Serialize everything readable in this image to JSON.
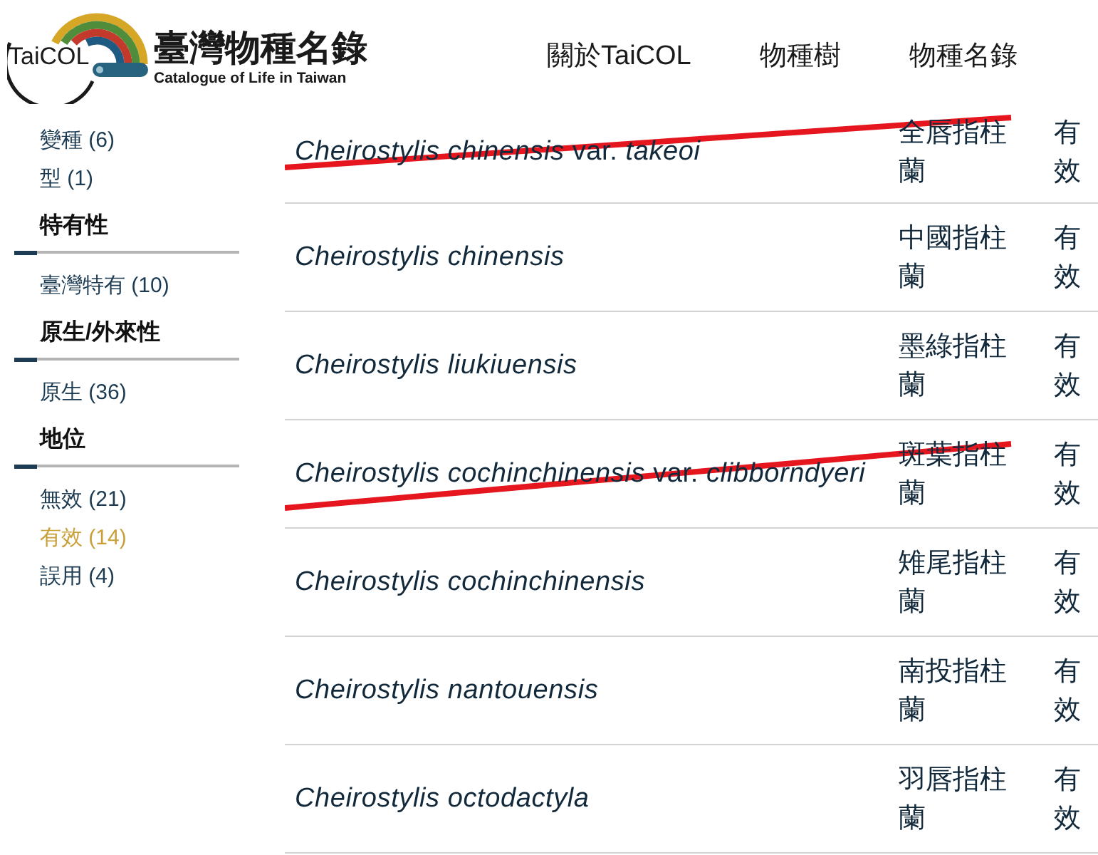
{
  "header": {
    "logo_text": "TaiCOL",
    "title": "臺灣物種名錄",
    "subtitle": "Catalogue of Life in Taiwan",
    "nav": [
      {
        "label": "關於TaiCOL"
      },
      {
        "label": "物種樹"
      },
      {
        "label": "物種名錄"
      }
    ]
  },
  "sidebar": {
    "groups": [
      {
        "items": [
          {
            "label": "變種 (6)",
            "selected": false
          },
          {
            "label": "型 (1)",
            "selected": false
          }
        ]
      },
      {
        "heading": "特有性",
        "items": [
          {
            "label": "臺灣特有 (10)",
            "selected": false
          }
        ]
      },
      {
        "heading": "原生/外來性",
        "items": [
          {
            "label": "原生 (36)",
            "selected": false
          }
        ]
      },
      {
        "heading": "地位",
        "items": [
          {
            "label": "無效 (21)",
            "selected": false
          },
          {
            "label": "有效 (14)",
            "selected": true
          },
          {
            "label": "誤用 (4)",
            "selected": false
          }
        ]
      }
    ]
  },
  "table": {
    "rows": [
      {
        "scientific_name": "Cheirostylis chinensis",
        "infraspecific_rank": "var.",
        "infraspecific_epithet": "takeoi",
        "common_name": "全唇指柱蘭",
        "status": "有效",
        "struck_out": true
      },
      {
        "scientific_name": "Cheirostylis chinensis",
        "common_name": "中國指柱蘭",
        "status": "有效",
        "struck_out": false
      },
      {
        "scientific_name": "Cheirostylis liukiuensis",
        "common_name": "墨綠指柱蘭",
        "status": "有效",
        "struck_out": false
      },
      {
        "scientific_name": "Cheirostylis cochinchinensis",
        "infraspecific_rank": "var.",
        "infraspecific_epithet": "clibborndyeri",
        "common_name": "斑葉指柱蘭",
        "status": "有效",
        "struck_out": true
      },
      {
        "scientific_name": "Cheirostylis cochinchinensis",
        "common_name": "雉尾指柱蘭",
        "status": "有效",
        "struck_out": false
      },
      {
        "scientific_name": "Cheirostylis nantouensis",
        "common_name": "南投指柱蘭",
        "status": "有效",
        "struck_out": false
      },
      {
        "scientific_name": "Cheirostylis octodactyla",
        "common_name": "羽唇指柱蘭",
        "status": "有效",
        "struck_out": false
      }
    ]
  }
}
